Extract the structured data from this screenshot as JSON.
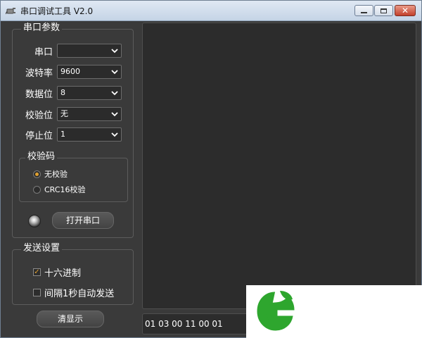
{
  "window": {
    "title": "串口调试工具 V2.0"
  },
  "serial_group": {
    "title": "串口参数",
    "fields": [
      {
        "label": "串口",
        "value": ""
      },
      {
        "label": "波特率",
        "value": "9600"
      },
      {
        "label": "数据位",
        "value": "8"
      },
      {
        "label": "校验位",
        "value": "无"
      },
      {
        "label": "停止位",
        "value": "1"
      }
    ]
  },
  "checksum_group": {
    "title": "校验码",
    "options": [
      {
        "label": "无校验",
        "selected": true
      },
      {
        "label": "CRC16校验",
        "selected": false
      }
    ]
  },
  "open_port_button": "打开串口",
  "send_group": {
    "title": "发送设置",
    "options": [
      {
        "label": "十六进制",
        "checked": true
      },
      {
        "label": "间隔1秒自动发送",
        "checked": false
      }
    ]
  },
  "clear_button": "清显示",
  "send_input_value": "01 03 00 11 00 01",
  "colors": {
    "accent": "#e0a030",
    "panel": "#3a3a3a",
    "display": "#2c2c2c",
    "watermark_green": "#2ea62e"
  },
  "icons": {
    "app": "plug-icon",
    "minimize": "minimize-icon",
    "maximize": "maximize-icon",
    "close": "close-icon",
    "watermark": "leaf-logo-icon"
  }
}
